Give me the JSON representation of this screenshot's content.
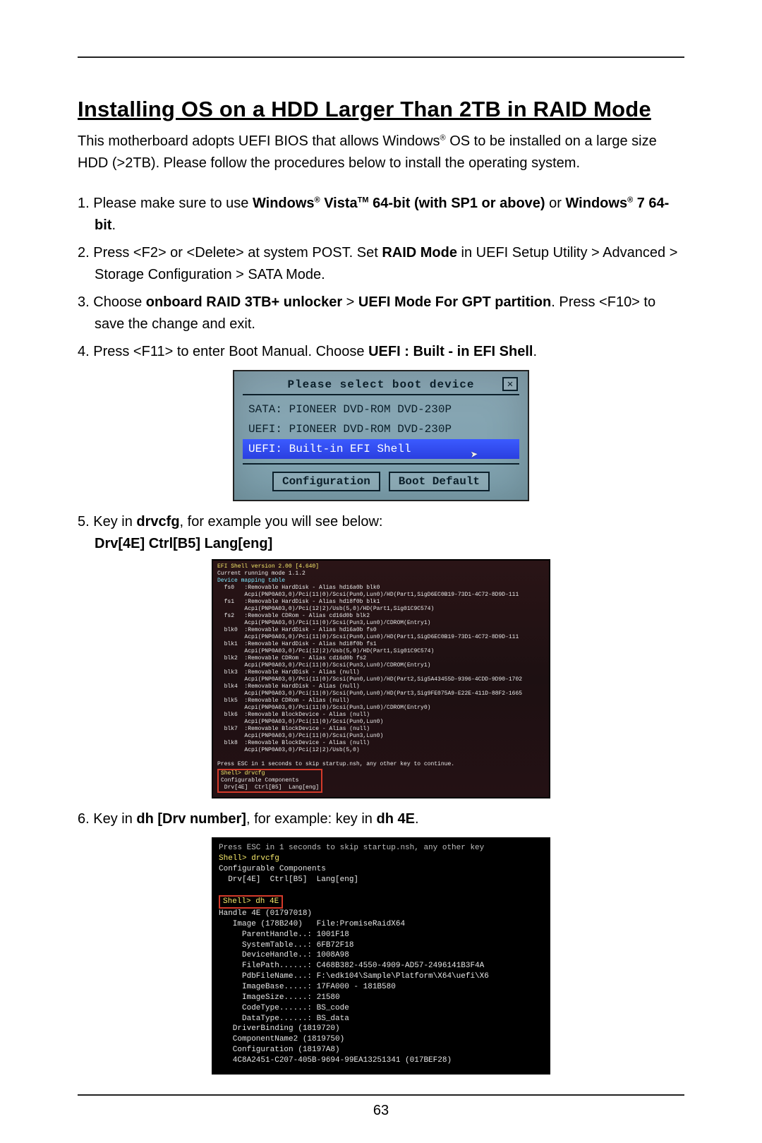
{
  "page_number": "63",
  "title": "Installing OS on a HDD Larger Than 2TB in RAID Mode",
  "intro": {
    "pre": "This motherboard adopts UEFI BIOS that allows Windows",
    "post": " OS to be installed on a large size HDD (>2TB). Please follow the procedures below to install the operating system."
  },
  "steps": {
    "s1": {
      "num": "1. ",
      "t1": "Please make sure to use ",
      "b1": "Windows",
      "b2": " Vista",
      "b3": " 64-bit (with SP1 or above)",
      "t2": " or ",
      "b4": "Windows",
      "b5": " 7 64-bit",
      "t3": "."
    },
    "s2": {
      "num": "2. ",
      "t1": "Press <F2> or <Delete> at system POST. Set ",
      "b1": "RAID Mode",
      "t2": " in UEFI Setup Utility > Advanced > Storage Configuration > SATA Mode."
    },
    "s3": {
      "num": "3. ",
      "t1": "Choose ",
      "b1": "onboard RAID 3TB+ unlocker",
      "t2": " > ",
      "b2": "UEFI Mode For GPT partition",
      "t3": ". Press <F10> to save the change and exit."
    },
    "s4": {
      "num": "4. ",
      "t1": "Press <F11> to enter Boot Manual. Choose ",
      "b1": "UEFI : Built - in EFI Shell",
      "t2": "."
    },
    "s5": {
      "num": "5. ",
      "t1": "Key in ",
      "b1": "drvcfg",
      "t2": ", for example you will see below:"
    },
    "s6": {
      "num": "6. ",
      "t1": "Key in ",
      "b1": "dh [Drv number]",
      "t2": ",  for example: key in ",
      "b2": "dh 4E",
      "t3": "."
    }
  },
  "boot": {
    "title": "Please select boot device",
    "close": "✕",
    "items": [
      "SATA: PIONEER DVD-ROM DVD-230P",
      "UEFI: PIONEER DVD-ROM DVD-230P",
      "UEFI: Built-in EFI Shell"
    ],
    "btn_config": "Configuration",
    "btn_default": "Boot Default"
  },
  "drv_line": "Drv[4E]   Ctrl[B5]   Lang[eng]",
  "shell1": {
    "l1": "EFI Shell version 2.00 [4.640]",
    "l2": "Current running mode 1.1.2",
    "l3": "Device mapping table",
    "map": "  fs0   :Removable HardDisk - Alias hd16a0b blk0\n        Acpi(PNP0A03,0)/Pci(11|0)/Scsi(Pun0,Lun0)/HD(Part1,SigD6EC0B19-73D1-4C72-8D9D-111\n  fs1   :Removable HardDisk - Alias hd18f0b blk1\n        Acpi(PNP0A03,0)/Pci(12|2)/Usb(5,0)/HD(Part1,Sig01C9C574)\n  fs2   :Removable CDRom - Alias cd16d0b blk2\n        Acpi(PNP0A03,0)/Pci(11|0)/Scsi(Pun3,Lun0)/CDROM(Entry1)\n  blk0  :Removable HardDisk - Alias hd16a0b fs0\n        Acpi(PNP0A03,0)/Pci(11|0)/Scsi(Pun0,Lun0)/HD(Part1,SigD6EC0B19-73D1-4C72-8D9D-111\n  blk1  :Removable HardDisk - Alias hd18f0b fs1\n        Acpi(PNP0A03,0)/Pci(12|2)/Usb(5,0)/HD(Part1,Sig01C9C574)\n  blk2  :Removable CDRom - Alias cd16d0b fs2\n        Acpi(PNP0A03,0)/Pci(11|0)/Scsi(Pun3,Lun0)/CDROM(Entry1)\n  blk3  :Removable HardDisk - Alias (null)\n        Acpi(PNP0A03,0)/Pci(11|0)/Scsi(Pun0,Lun0)/HD(Part2,Sig5A43455D-9396-4CDD-9D90-1702\n  blk4  :Removable HardDisk - Alias (null)\n        Acpi(PNP0A03,0)/Pci(11|0)/Scsi(Pun0,Lun0)/HD(Part3,Sig9FE075A9-E22E-411D-88F2-1665\n  blk5  :Removable CDRom - Alias (null)\n        Acpi(PNP0A03,0)/Pci(11|0)/Scsi(Pun3,Lun0)/CDROM(Entry0)\n  blk6  :Removable BlockDevice - Alias (null)\n        Acpi(PNP0A03,0)/Pci(11|0)/Scsi(Pun0,Lun0)\n  blk7  :Removable BlockDevice - Alias (null)\n        Acpi(PNP0A03,0)/Pci(11|0)/Scsi(Pun3,Lun0)\n  blk8  :Removable BlockDevice - Alias (null)\n        Acpi(PNP0A03,0)/Pci(12|2)/Usb(5,0)",
    "press": "Press ESC in 1 seconds to skip startup.nsh, any other key to continue.",
    "shell": "Shell> drvcfg",
    "conf": "Configurable Components",
    "drv": " Drv[4E]  Ctrl[B5]  Lang[eng]"
  },
  "shell2": {
    "l1": "Press ESC in 1 seconds to skip startup.nsh, any other key",
    "l2": "Shell> drvcfg",
    "l3": "Configurable Components",
    "l4": "  Drv[4E]  Ctrl[B5]  Lang[eng]",
    "l5": "Shell> dh 4E",
    "body": "Handle 4E (01797018)\n   Image (178B240)   File:PromiseRaidX64\n     ParentHandle..: 1001F18\n     SystemTable...: 6FB72F18\n     DeviceHandle..: 1008A98\n     FilePath......: C468B382-4550-4909-AD57-2496141B3F4A\n     PdbFileName...: F:\\edk104\\Sample\\Platform\\X64\\uefi\\X6\n     ImageBase.....: 17FA000 - 181B580\n     ImageSize.....: 21580\n     CodeType......: BS_code\n     DataType......: BS_data\n   DriverBinding (1819720)\n   ComponentName2 (1819750)\n   Configuration (18197A8)\n   4C8A2451-C207-405B-9694-99EA13251341 (017BEF28)"
  }
}
